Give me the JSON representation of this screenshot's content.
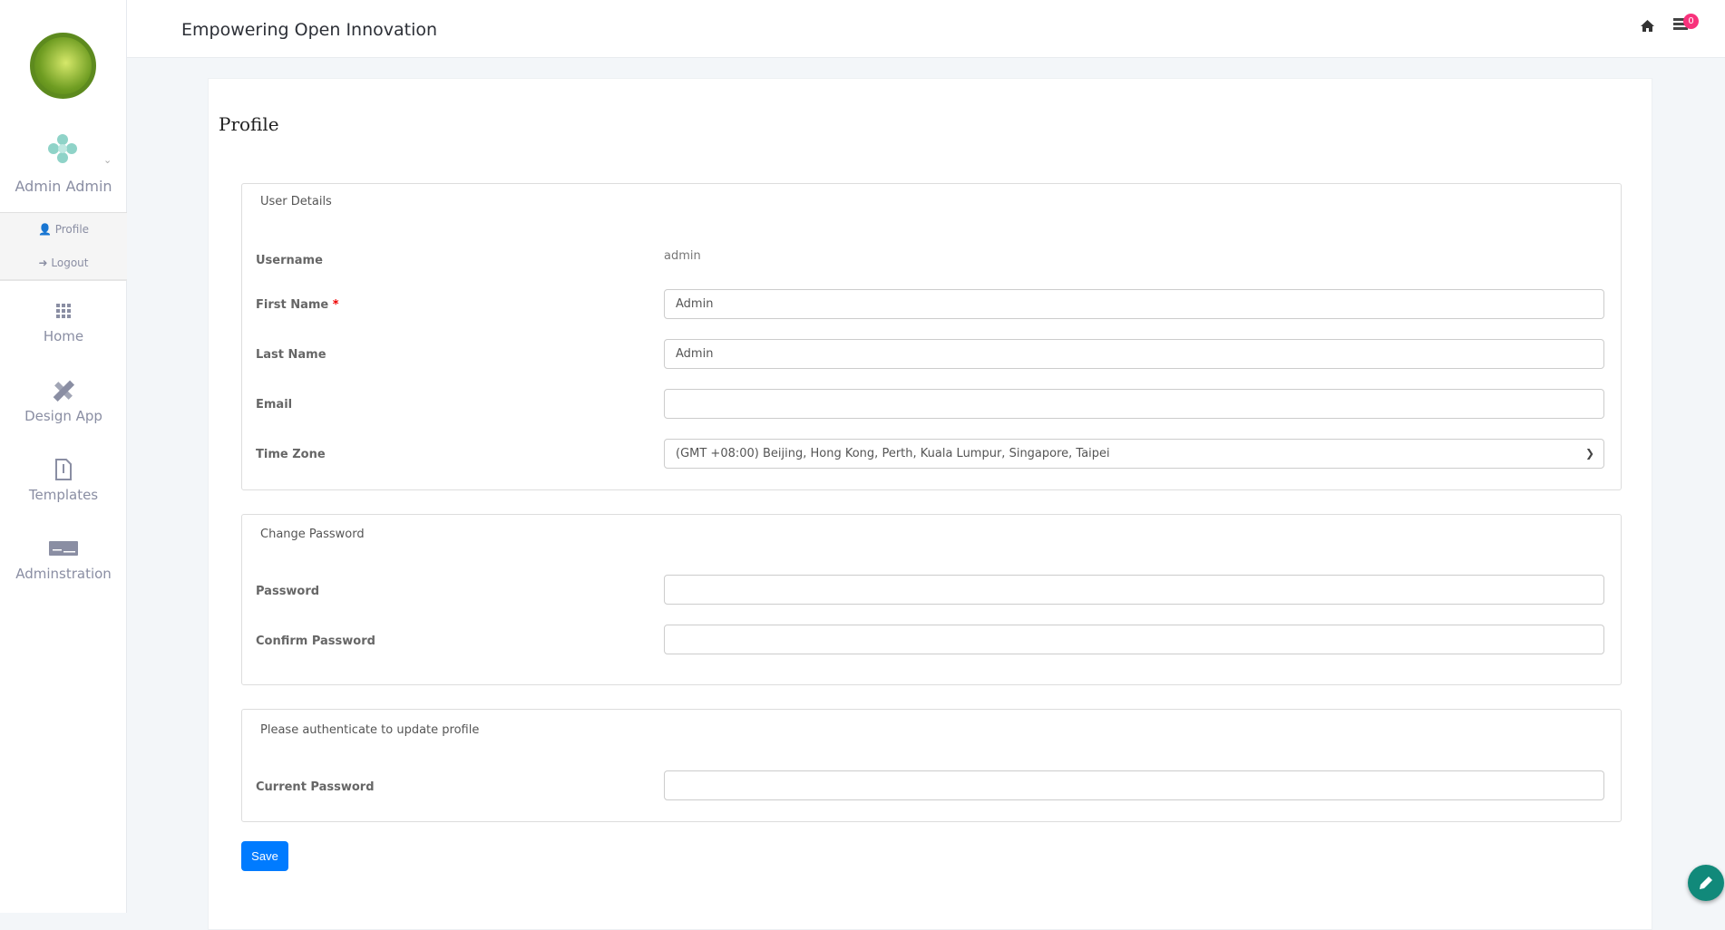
{
  "header": {
    "title": "Empowering Open Innovation",
    "notification_count": "0"
  },
  "sidebar": {
    "user_name": "Admin Admin",
    "user_menu": [
      {
        "label": "Profile"
      },
      {
        "label": "Logout"
      }
    ],
    "nav": [
      {
        "label": "Home",
        "icon": "grid-icon"
      },
      {
        "label": "Design App",
        "icon": "pencil-ruler-icon"
      },
      {
        "label": "Templates",
        "icon": "file-zip-icon"
      },
      {
        "label": "Adminstration",
        "icon": "keyboard-icon"
      }
    ]
  },
  "page": {
    "title": "Profile",
    "user_details": {
      "legend": "User Details",
      "username_label": "Username",
      "username_value": "admin",
      "first_name_label": "First Name",
      "required_mark": "*",
      "first_name_value": "Admin",
      "last_name_label": "Last Name",
      "last_name_value": "Admin",
      "email_label": "Email",
      "email_value": "",
      "timezone_label": "Time Zone",
      "timezone_value": "(GMT +08:00) Beijing, Hong Kong, Perth, Kuala Lumpur, Singapore, Taipei"
    },
    "change_password": {
      "legend": "Change Password",
      "password_label": "Password",
      "confirm_label": "Confirm Password"
    },
    "authenticate": {
      "legend": "Please authenticate to update profile",
      "current_label": "Current Password"
    },
    "save_label": "Save"
  },
  "colors": {
    "primary": "#007bff",
    "fab": "#11897a",
    "badge": "#f8337c"
  }
}
